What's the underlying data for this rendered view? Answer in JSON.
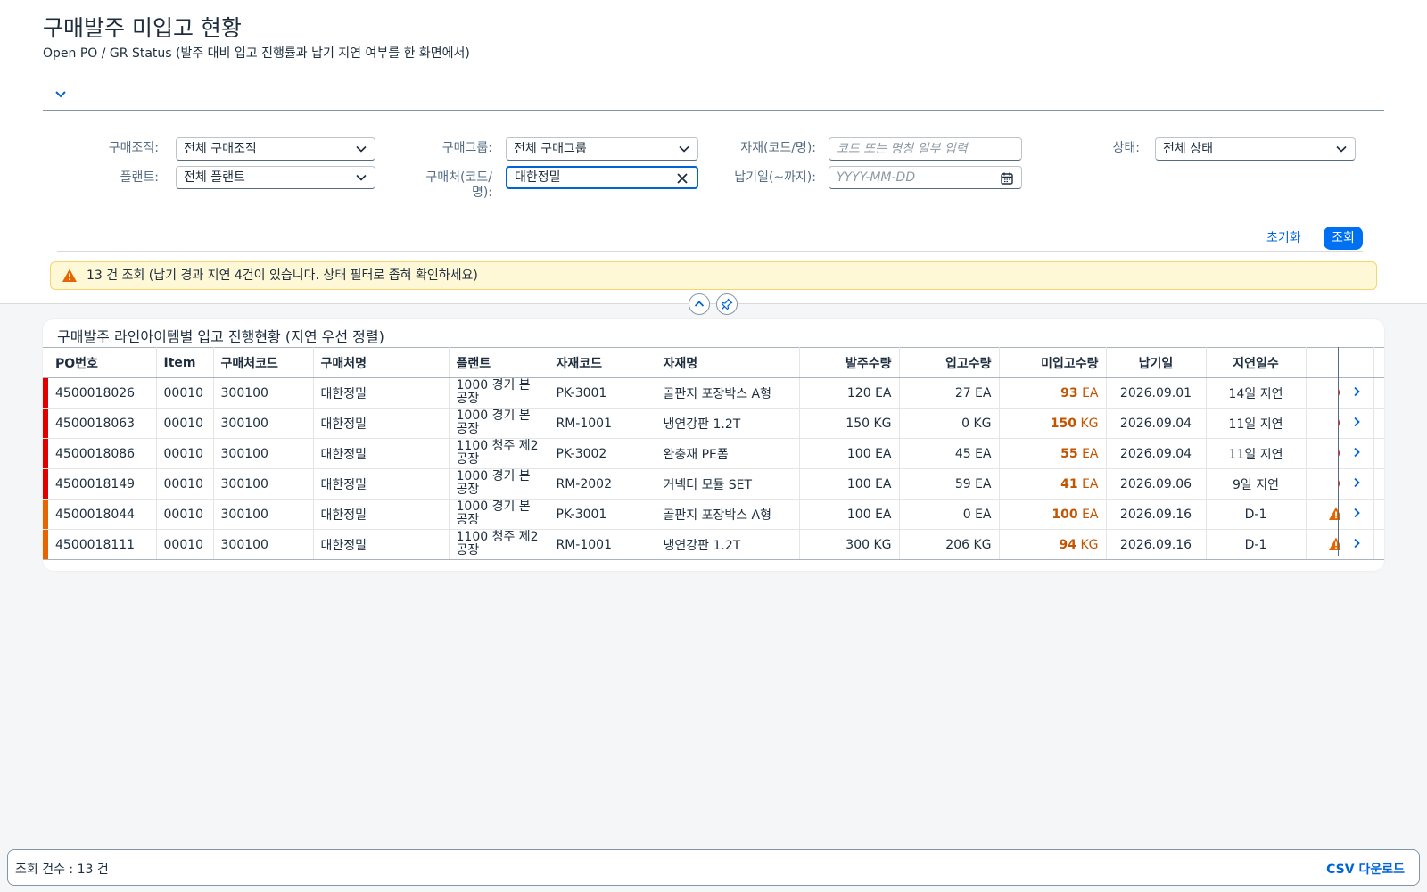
{
  "page": {
    "title": "구매발주 미입고 현황",
    "subtitle": "Open PO / GR Status (발주 대비 입고 진행률과 납기 지연 여부를 한 화면에서)"
  },
  "filters": {
    "purch_org": {
      "label": "구매조직:",
      "value": "전체 구매조직"
    },
    "plant": {
      "label": "플랜트:",
      "value": "전체 플랜트"
    },
    "purch_group": {
      "label": "구매그룹:",
      "value": "전체 구매그룹"
    },
    "vendor": {
      "label_line1": "구매처(코드/",
      "label_line2": "명):",
      "value": "대한정밀"
    },
    "material": {
      "label": "자재(코드/명):",
      "placeholder": "코드 또는 명칭 일부 입력"
    },
    "due_date": {
      "label": "납기일(~까지):",
      "placeholder": "YYYY-MM-DD"
    },
    "status": {
      "label": "상태:",
      "value": "전체 상태"
    }
  },
  "actions": {
    "reset": "초기화",
    "search": "조회"
  },
  "message": "13 건 조회 (납기 경과 지연 4건이 있습니다. 상태 필터로 좁혀 확인하세요)",
  "table": {
    "title": "구매발주 라인아이템별 입고 진행현황 (지연 우선 정렬)",
    "columns": [
      "PO번호",
      "Item",
      "구매처코드",
      "구매처명",
      "플랜트",
      "자재코드",
      "자재명",
      "발주수량",
      "입고수량",
      "미입고수량",
      "납기일",
      "지연일수"
    ],
    "rows": [
      {
        "po": "4500018026",
        "item": "00010",
        "vendor_code": "300100",
        "vendor_name": "대한정밀",
        "plant": "1000 경기 본공장",
        "mat_code": "PK-3001",
        "mat_name": "골판지 포장박스 A형",
        "order_qty": "120 EA",
        "gr_qty": "27 EA",
        "open_num": "93",
        "open_unit": "EA",
        "due": "2026.09.01",
        "delay": "14일 지연",
        "status": "error"
      },
      {
        "po": "4500018063",
        "item": "00010",
        "vendor_code": "300100",
        "vendor_name": "대한정밀",
        "plant": "1000 경기 본공장",
        "mat_code": "RM-1001",
        "mat_name": "냉연강판 1.2T",
        "order_qty": "150 KG",
        "gr_qty": "0 KG",
        "open_num": "150",
        "open_unit": "KG",
        "due": "2026.09.04",
        "delay": "11일 지연",
        "status": "error"
      },
      {
        "po": "4500018086",
        "item": "00010",
        "vendor_code": "300100",
        "vendor_name": "대한정밀",
        "plant": "1100 청주 제2공장",
        "mat_code": "PK-3002",
        "mat_name": "완충재 PE폼",
        "order_qty": "100 EA",
        "gr_qty": "45 EA",
        "open_num": "55",
        "open_unit": "EA",
        "due": "2026.09.04",
        "delay": "11일 지연",
        "status": "error"
      },
      {
        "po": "4500018149",
        "item": "00010",
        "vendor_code": "300100",
        "vendor_name": "대한정밀",
        "plant": "1000 경기 본공장",
        "mat_code": "RM-2002",
        "mat_name": "커넥터 모듈 SET",
        "order_qty": "100 EA",
        "gr_qty": "59 EA",
        "open_num": "41",
        "open_unit": "EA",
        "due": "2026.09.06",
        "delay": "9일 지연",
        "status": "error"
      },
      {
        "po": "4500018044",
        "item": "00010",
        "vendor_code": "300100",
        "vendor_name": "대한정밀",
        "plant": "1000 경기 본공장",
        "mat_code": "PK-3001",
        "mat_name": "골판지 포장박스 A형",
        "order_qty": "100 EA",
        "gr_qty": "0 EA",
        "open_num": "100",
        "open_unit": "EA",
        "due": "2026.09.16",
        "delay": "D-1",
        "status": "warning"
      },
      {
        "po": "4500018111",
        "item": "00010",
        "vendor_code": "300100",
        "vendor_name": "대한정밀",
        "plant": "1100 청주 제2공장",
        "mat_code": "RM-1001",
        "mat_name": "냉연강판 1.2T",
        "order_qty": "300 KG",
        "gr_qty": "206 KG",
        "open_num": "94",
        "open_unit": "KG",
        "due": "2026.09.16",
        "delay": "D-1",
        "status": "warning"
      }
    ]
  },
  "footer": {
    "count": "조회 건수 : 13 건",
    "csv": "CSV 다운로드"
  },
  "colors": {
    "error": "#e00000",
    "warning": "#e76500",
    "brand": "#0070f2",
    "critical_text": "#c35500"
  },
  "icons": {
    "expand": "chevron-down-icon",
    "select": "chevron-down-icon",
    "clear": "close-icon",
    "calendar": "calendar-icon",
    "message": "warning-icon",
    "collapse": "chevron-up-icon",
    "pin": "pin-icon",
    "row_nav": "chevron-right-icon"
  }
}
